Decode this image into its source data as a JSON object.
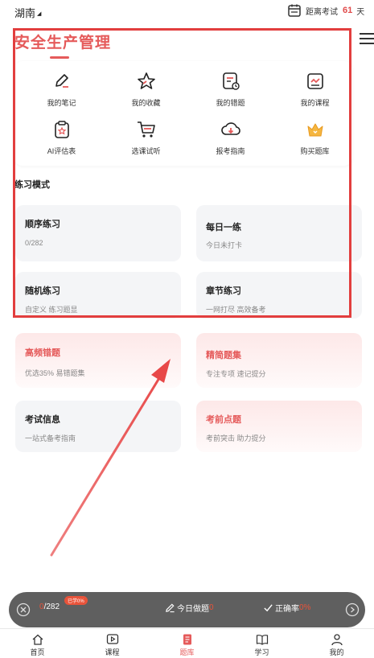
{
  "header": {
    "region": "湖南",
    "exam_label": "距离考试",
    "exam_days": "61",
    "exam_unit": "天",
    "menu_icon": "hamburger-icon"
  },
  "title": "安全生产管理",
  "grid": [
    {
      "label": "我的笔记",
      "icon": "note-pen-icon"
    },
    {
      "label": "我的收藏",
      "icon": "star-icon"
    },
    {
      "label": "我的错题",
      "icon": "wrong-questions-icon"
    },
    {
      "label": "我的课程",
      "icon": "course-chart-icon"
    },
    {
      "label": "AI评估表",
      "icon": "ai-assessment-icon"
    },
    {
      "label": "选课试听",
      "icon": "cart-icon"
    },
    {
      "label": "报考指南",
      "icon": "download-cloud-icon"
    },
    {
      "label": "购买题库",
      "icon": "crown-icon"
    }
  ],
  "section_label": "练习模式",
  "modes": {
    "sequential": {
      "title": "顺序练习",
      "sub": "0/282"
    },
    "daily": {
      "title": "每日一练",
      "sub": "今日未打卡"
    },
    "random": {
      "title": "随机练习",
      "sub": "自定义 练习题显"
    },
    "chapter": {
      "title": "章节练习",
      "sub": "一网打尽 高效备考"
    },
    "frequent": {
      "title": "高频错题",
      "sub": "优选35% 易错题集"
    },
    "selected": {
      "title": "精简题集",
      "sub": "专注专项 速记提分"
    },
    "exam_info": {
      "title": "考试信息",
      "sub": "一站式备考指南"
    },
    "pre_exam": {
      "title": "考前点题",
      "sub": "考前突击 助力提分"
    }
  },
  "float_bar": {
    "progress_done": "0",
    "progress_total": "/282",
    "badge": "已学0%",
    "today_label": "今日做题",
    "today_count": "0",
    "accuracy_label": "正确率",
    "accuracy_value": "0%"
  },
  "tabs": [
    {
      "label": "首页",
      "icon": "home-icon"
    },
    {
      "label": "课程",
      "icon": "video-play-icon"
    },
    {
      "label": "题库",
      "icon": "question-bank-icon",
      "active": true
    },
    {
      "label": "学习",
      "icon": "book-icon"
    },
    {
      "label": "我的",
      "icon": "user-icon"
    }
  ],
  "colors": {
    "accent": "#e55a5a",
    "annotation": "#e23e3e",
    "bar": "#5f5f5f"
  }
}
